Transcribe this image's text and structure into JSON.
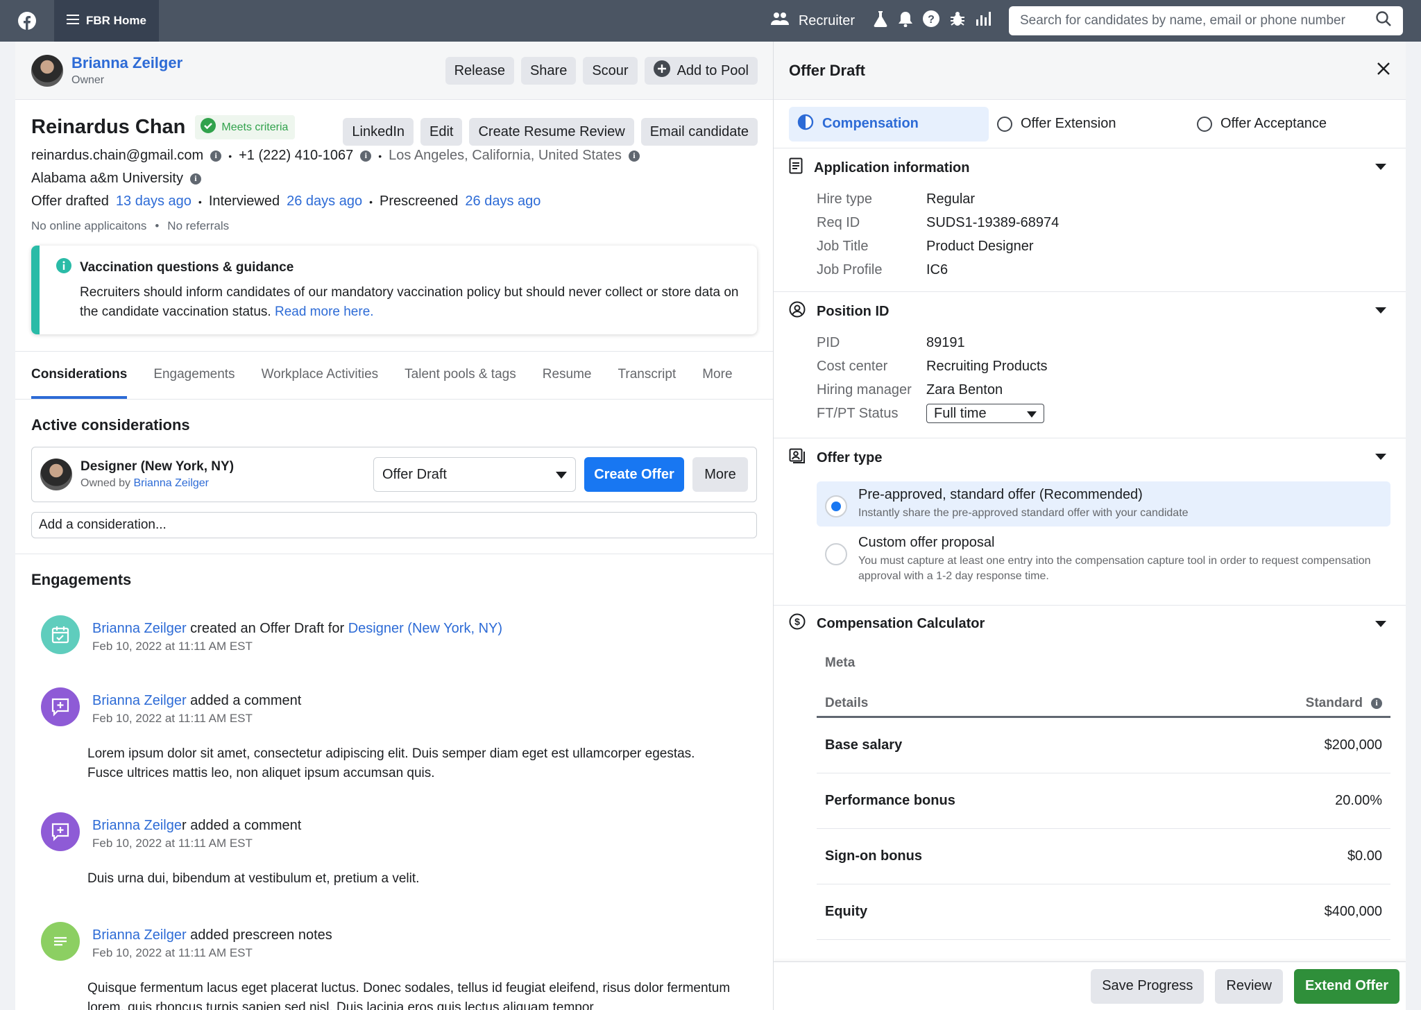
{
  "topbar": {
    "home_label": "FBR Home",
    "role_label": "Recruiter",
    "search_placeholder": "Search for candidates by name, email or phone number"
  },
  "owner": {
    "name": "Brianna Zeilger",
    "role": "Owner",
    "actions": [
      "Release",
      "Share",
      "Scour",
      "Add to Pool"
    ]
  },
  "candidate": {
    "name": "Reinardus Chan",
    "badge": "Meets criteria",
    "actions": [
      "LinkedIn",
      "Edit",
      "Create Resume Review",
      "Email candidate"
    ],
    "email": "reinardus.chain@gmail.com",
    "phone": "+1 (222) 410-1067",
    "location": "Los Angeles, California, United States",
    "school": "Alabama a&m University",
    "timeline": [
      {
        "label": "Offer drafted",
        "when": "13 days ago"
      },
      {
        "label": "Interviewed",
        "when": "26 days ago"
      },
      {
        "label": "Prescreened",
        "when": "26 days ago"
      }
    ],
    "meta": [
      "No online applicaitons",
      "No referrals"
    ]
  },
  "alert": {
    "title": "Vaccination questions & guidance",
    "body": "Recruiters should inform candidates of our mandatory vaccination policy but should never collect or store data on the candidate vaccination status.",
    "link": "Read more here."
  },
  "tabs": [
    "Considerations",
    "Engagements",
    "Workplace Activities",
    "Talent pools & tags",
    "Resume",
    "Transcript",
    "More"
  ],
  "considerations": {
    "title": "Active considerations",
    "item": {
      "title": "Designer (New York, NY)",
      "owned_prefix": "Owned by",
      "owner": "Brianna Zeilger",
      "stage": "Offer Draft",
      "create_label": "Create Offer",
      "more_label": "More"
    },
    "add_placeholder": "Add a consideration..."
  },
  "engagements": {
    "title": "Engagements",
    "items": [
      {
        "actor": "Brianna Zeilger",
        "action": " created an Offer Draft for ",
        "target": "Designer (New York, NY)",
        "time": "Feb 10, 2022 at 11:11 AM EST",
        "body": ""
      },
      {
        "actor": "Brianna Zeilger",
        "action": " added a comment",
        "target": "",
        "time": "Feb 10, 2022 at 11:11 AM EST",
        "body": "Lorem ipsum dolor sit amet, consectetur adipiscing elit. Duis semper diam eget est ullamcorper egestas. Fusce ultrices mattis leo, non aliquet ipsum accumsan quis."
      },
      {
        "actor": "Brianna Zeilge",
        "actor_suffix": "r",
        "action": " added a comment",
        "target": "",
        "time": "Feb 10, 2022 at 11:11 AM EST",
        "body": "Duis urna dui, bibendum at vestibulum et, pretium a velit."
      },
      {
        "actor": "Brianna Zeilger",
        "action": " added prescreen notes",
        "target": "",
        "time": "Feb 10, 2022 at 11:11 AM EST",
        "body": "Quisque fermentum lacus eget placerat luctus. Donec sodales, tellus id  feugiat eleifend, risus dolor fermentum lorem, quis rhoncus turpis  sapien sed nisl. Duis lacinia eros quis lectus aliquam tempor"
      }
    ]
  },
  "offer": {
    "title": "Offer Draft",
    "steps": [
      "Compensation",
      "Offer Extension",
      "Offer Acceptance"
    ],
    "application": {
      "title": "Application information",
      "rows": [
        {
          "k": "Hire type",
          "v": "Regular"
        },
        {
          "k": "Req ID",
          "v": "SUDS1-19389-68974"
        },
        {
          "k": "Job Title",
          "v": "Product Designer"
        },
        {
          "k": "Job Profile",
          "v": "IC6"
        }
      ]
    },
    "position": {
      "title": "Position ID",
      "rows": [
        {
          "k": "PID",
          "v": "89191"
        },
        {
          "k": "Cost center",
          "v": "Recruiting Products"
        },
        {
          "k": "Hiring manager",
          "v": "Zara Benton"
        }
      ],
      "status_label": "FT/PT Status",
      "status_value": "Full time"
    },
    "offer_type": {
      "title": "Offer type",
      "options": [
        {
          "title": "Pre-approved, standard offer (Recommended)",
          "desc": "Instantly share the pre-approved standard offer with your candidate"
        },
        {
          "title": "Custom offer proposal",
          "desc": "You must capture at least one entry into the compensation capture tool in order to request compensation approval with a 1-2 day response time."
        }
      ]
    },
    "calculator": {
      "title": "Compensation Calculator",
      "company": "Meta",
      "col_details": "Details",
      "col_standard": "Standard",
      "rows": [
        {
          "k": "Base salary",
          "v": "$200,000"
        },
        {
          "k": "Performance bonus",
          "v": "20.00%"
        },
        {
          "k": "Sign-on bonus",
          "v": "$0.00"
        },
        {
          "k": "Equity",
          "v": "$400,000"
        }
      ]
    },
    "footer": {
      "save": "Save Progress",
      "review": "Review",
      "extend": "Extend Offer"
    }
  },
  "colors": {
    "accent": "#1877f2",
    "link": "#2d6bd6",
    "success": "#31a24c",
    "teal": "#2abba7",
    "purple": "#8e5bd6",
    "lime": "#8ccf62",
    "green_button": "#2f8f3a"
  }
}
